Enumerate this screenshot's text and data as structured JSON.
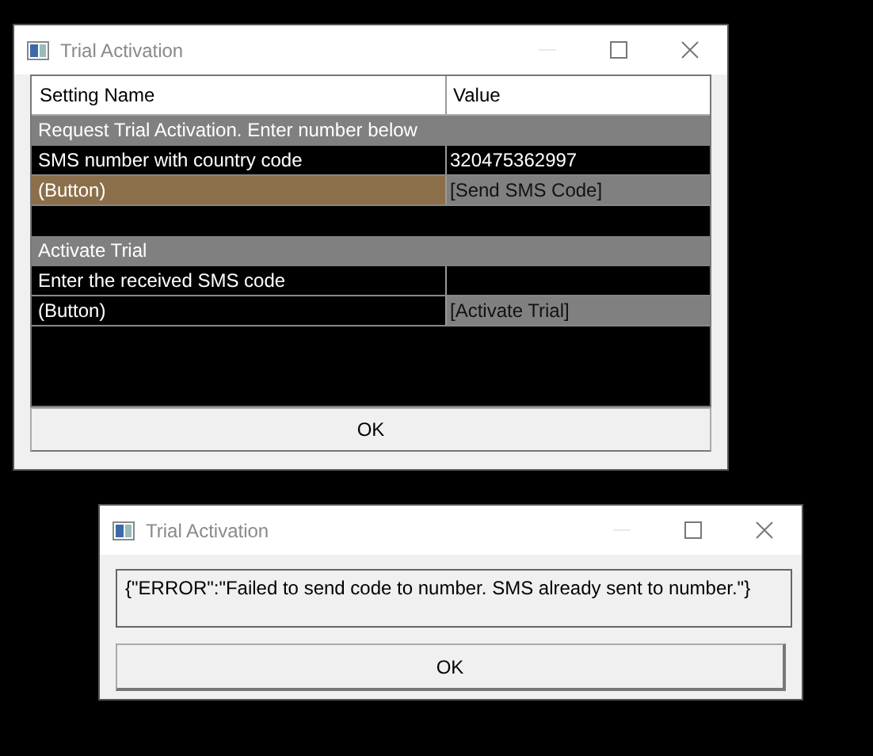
{
  "windows": [
    {
      "title": "Trial Activation",
      "table": {
        "columns": [
          "Setting Name",
          "Value"
        ],
        "rows": [
          {
            "kind": "section",
            "name": "Request Trial Activation. Enter number below"
          },
          {
            "kind": "field",
            "name": "SMS number with country code",
            "value": "320475362997",
            "selected": false
          },
          {
            "kind": "button",
            "name": " (Button)",
            "value": "[Send SMS Code]",
            "selected": true
          },
          {
            "kind": "blank"
          },
          {
            "kind": "section",
            "name": "Activate Trial"
          },
          {
            "kind": "field",
            "name": "Enter the received SMS code",
            "selected": false
          },
          {
            "kind": "button",
            "name": " (Button)",
            "value": "[Activate Trial]",
            "selected": false
          }
        ]
      },
      "button": "OK"
    },
    {
      "title": "Trial Activation",
      "message": "{\"ERROR\":\"Failed to send code to number. SMS already sent to number.\"}",
      "button": "OK"
    }
  ]
}
